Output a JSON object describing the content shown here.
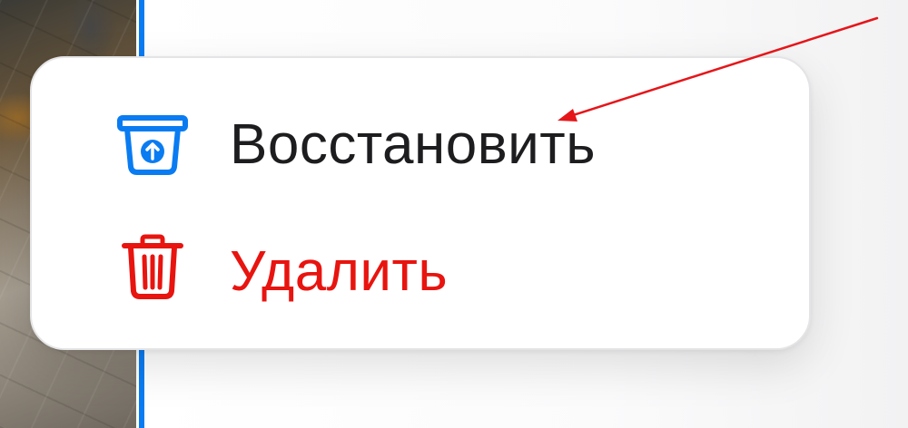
{
  "colors": {
    "accent_blue": "#0a7cf2",
    "destructive_red": "#e8140f",
    "annotation_red": "#e5161a",
    "text_primary": "#1d1d1f"
  },
  "context_menu": {
    "items": [
      {
        "label": "Восстановить",
        "icon": "restore-box-icon"
      },
      {
        "label": "Удалить",
        "icon": "trash-icon"
      }
    ]
  }
}
